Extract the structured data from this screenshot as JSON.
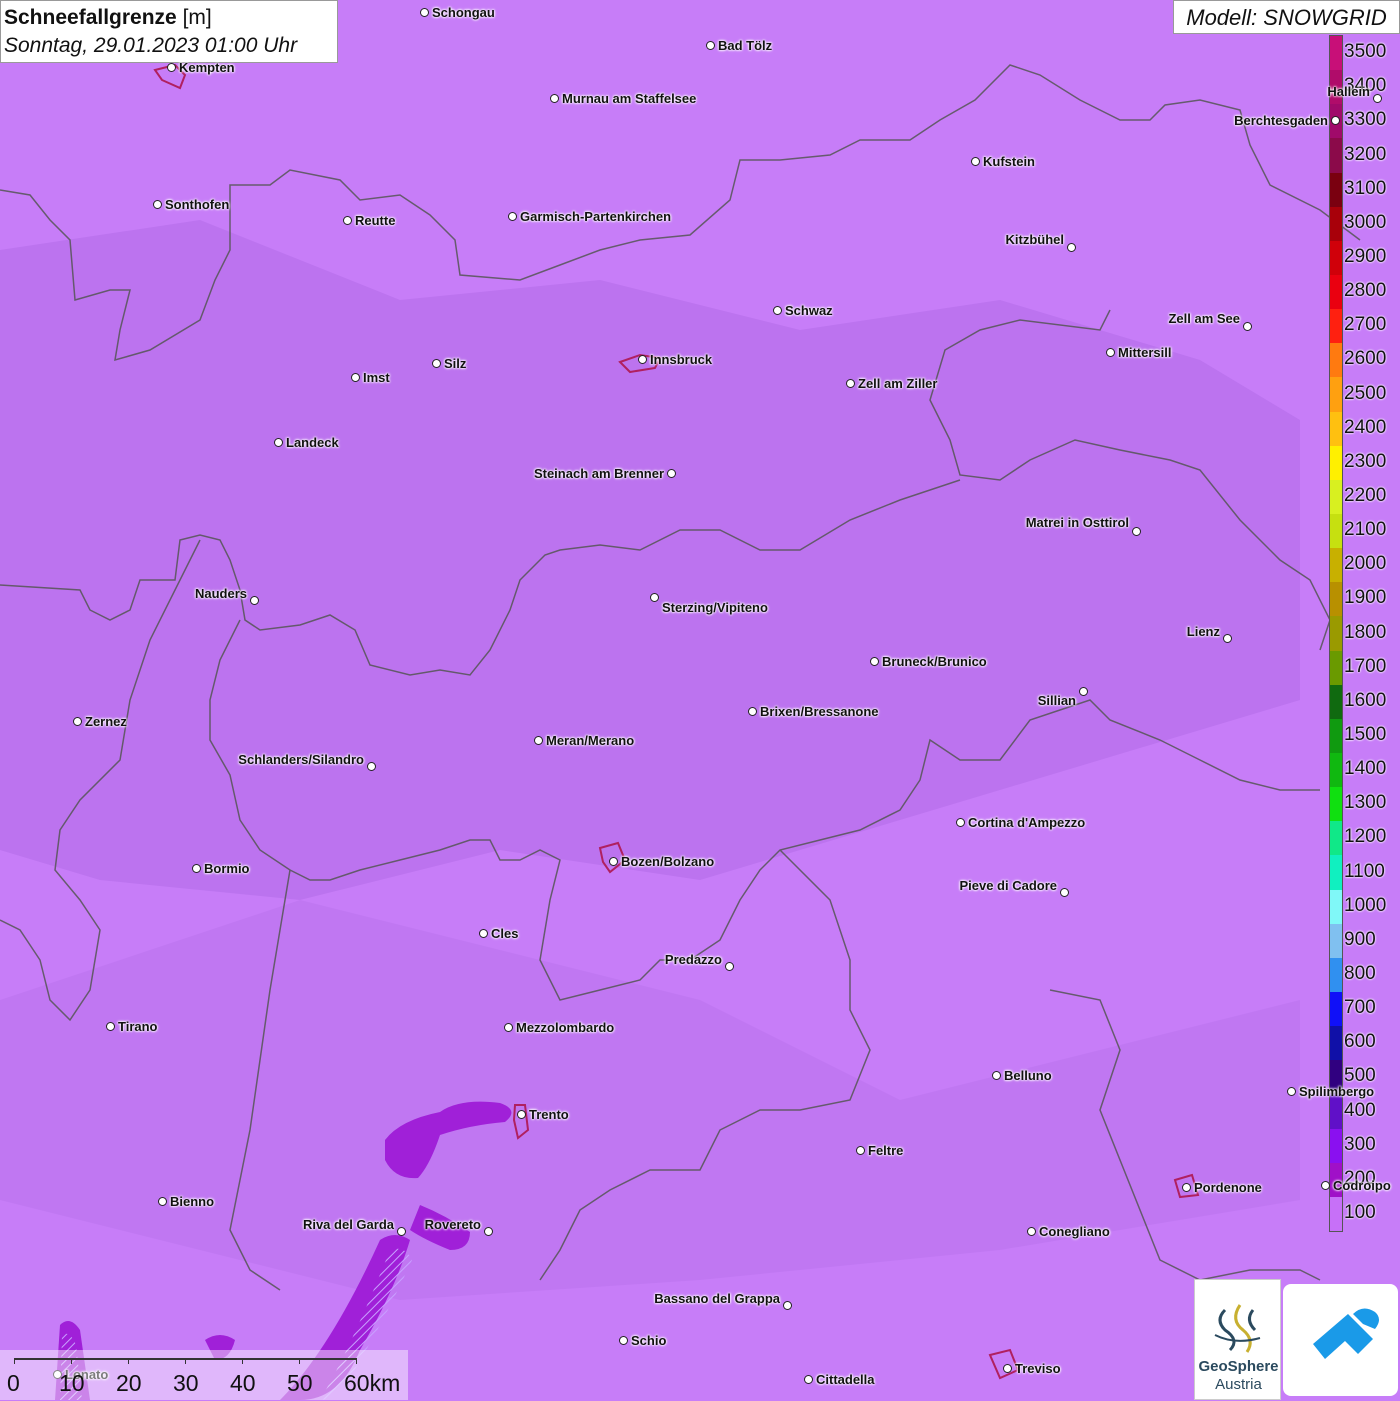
{
  "title": {
    "bold": "Schneefallgrenze",
    "unit": "[m]",
    "datetime": "Sonntag, 29.01.2023 01:00 Uhr"
  },
  "model": "Modell: SNOWGRID",
  "legend": [
    {
      "value": "3500",
      "color": "#c80f78"
    },
    {
      "value": "3400",
      "color": "#b00c6a"
    },
    {
      "value": "3300",
      "color": "#a00a6a"
    },
    {
      "value": "3200",
      "color": "#8b0a4a"
    },
    {
      "value": "3100",
      "color": "#7a0010"
    },
    {
      "value": "3000",
      "color": "#a8000a"
    },
    {
      "value": "2900",
      "color": "#d0000a"
    },
    {
      "value": "2800",
      "color": "#ea0010"
    },
    {
      "value": "2700",
      "color": "#ff2010"
    },
    {
      "value": "2600",
      "color": "#ff7a10"
    },
    {
      "value": "2500",
      "color": "#ffa010"
    },
    {
      "value": "2400",
      "color": "#ffc010"
    },
    {
      "value": "2300",
      "color": "#fff000"
    },
    {
      "value": "2200",
      "color": "#d8f020"
    },
    {
      "value": "2100",
      "color": "#c6e010"
    },
    {
      "value": "2000",
      "color": "#c8b000"
    },
    {
      "value": "1900",
      "color": "#b89000"
    },
    {
      "value": "1800",
      "color": "#9a9a00"
    },
    {
      "value": "1700",
      "color": "#6a9a00"
    },
    {
      "value": "1600",
      "color": "#106a10"
    },
    {
      "value": "1500",
      "color": "#109a10"
    },
    {
      "value": "1400",
      "color": "#10b810"
    },
    {
      "value": "1300",
      "color": "#10e010"
    },
    {
      "value": "1200",
      "color": "#10e888"
    },
    {
      "value": "1100",
      "color": "#10f0c0"
    },
    {
      "value": "1000",
      "color": "#80f8f8"
    },
    {
      "value": "900",
      "color": "#80c0f0"
    },
    {
      "value": "800",
      "color": "#3090f0"
    },
    {
      "value": "700",
      "color": "#1010f8"
    },
    {
      "value": "600",
      "color": "#1010a8"
    },
    {
      "value": "500",
      "color": "#300080"
    },
    {
      "value": "400",
      "color": "#6010c8"
    },
    {
      "value": "300",
      "color": "#8a10f0"
    },
    {
      "value": "200",
      "color": "#a010c8"
    },
    {
      "value": "100",
      "color": "#c770f8"
    }
  ],
  "cities": [
    {
      "name": "Schongau",
      "side": "right"
    },
    {
      "name": "Bad Tölz",
      "side": "right"
    },
    {
      "name": "Kempten",
      "side": "right"
    },
    {
      "name": "Murnau am Staffelsee",
      "side": "right"
    },
    {
      "name": "Hallein",
      "side": "left"
    },
    {
      "name": "Berchtesgaden",
      "side": "left"
    },
    {
      "name": "Kufstein",
      "side": "right"
    },
    {
      "name": "Sonthofen",
      "side": "right"
    },
    {
      "name": "Reutte",
      "side": "right"
    },
    {
      "name": "Garmisch-Partenkirchen",
      "side": "right"
    },
    {
      "name": "Kitzbühel",
      "side": "left"
    },
    {
      "name": "Schwaz",
      "side": "right"
    },
    {
      "name": "Zell am See",
      "side": "left"
    },
    {
      "name": "Innsbruck",
      "side": "right"
    },
    {
      "name": "Mittersill",
      "side": "right"
    },
    {
      "name": "Silz",
      "side": "right"
    },
    {
      "name": "Imst",
      "side": "right"
    },
    {
      "name": "Zell am Ziller",
      "side": "right"
    },
    {
      "name": "Landeck",
      "side": "right"
    },
    {
      "name": "Steinach am Brenner",
      "side": "left"
    },
    {
      "name": "Matrei in Osttirol",
      "side": "left"
    },
    {
      "name": "Nauders",
      "side": "left"
    },
    {
      "name": "Sterzing/Vipiteno",
      "side": "right"
    },
    {
      "name": "Lienz",
      "side": "left"
    },
    {
      "name": "Bruneck/Brunico",
      "side": "right"
    },
    {
      "name": "Sillian",
      "side": "left"
    },
    {
      "name": "Zernez",
      "side": "right"
    },
    {
      "name": "Brixen/Bressanone",
      "side": "right"
    },
    {
      "name": "Meran/Merano",
      "side": "right"
    },
    {
      "name": "Schlanders/Silandro",
      "side": "left"
    },
    {
      "name": "Cortina d'Ampezzo",
      "side": "right"
    },
    {
      "name": "Bozen/Bolzano",
      "side": "right"
    },
    {
      "name": "Bormio",
      "side": "right"
    },
    {
      "name": "Pieve di Cadore",
      "side": "left"
    },
    {
      "name": "Cles",
      "side": "right"
    },
    {
      "name": "Predazzo",
      "side": "left"
    },
    {
      "name": "Tirano",
      "side": "right"
    },
    {
      "name": "Mezzolombardo",
      "side": "right"
    },
    {
      "name": "Belluno",
      "side": "right"
    },
    {
      "name": "Spilimbergo",
      "side": "right"
    },
    {
      "name": "Trento",
      "side": "right"
    },
    {
      "name": "Feltre",
      "side": "right"
    },
    {
      "name": "Pordenone",
      "side": "right"
    },
    {
      "name": "Codroipo",
      "side": "right"
    },
    {
      "name": "Bienno",
      "side": "right"
    },
    {
      "name": "Riva del Garda",
      "side": "left"
    },
    {
      "name": "Rovereto",
      "side": "left"
    },
    {
      "name": "Conegliano",
      "side": "right"
    },
    {
      "name": "Bassano del Grappa",
      "side": "left"
    },
    {
      "name": "Schio",
      "side": "right"
    },
    {
      "name": "Lonato",
      "side": "right"
    },
    {
      "name": "Treviso",
      "side": "right"
    },
    {
      "name": "Cittadella",
      "side": "right"
    }
  ],
  "scale": {
    "labels": [
      "0",
      "10",
      "20",
      "30",
      "40",
      "50",
      "60km"
    ]
  },
  "logos": {
    "geosphere_line1": "GeoSphere",
    "geosphere_line2": "Austria"
  }
}
